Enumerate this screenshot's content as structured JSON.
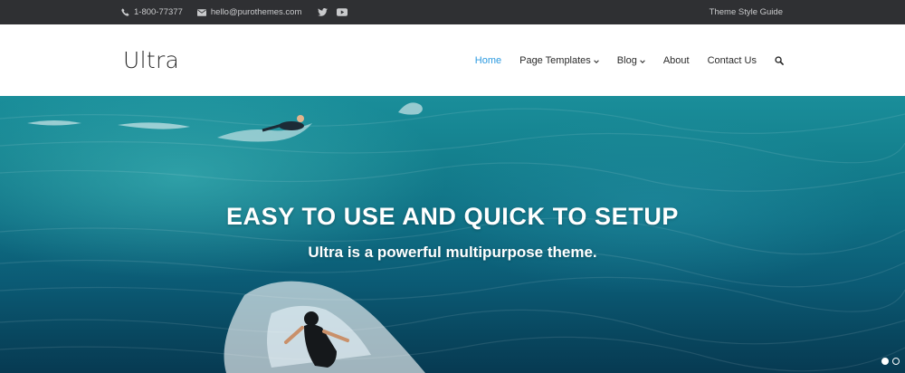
{
  "topbar": {
    "phone": "1-800-77377",
    "email": "hello@purothemes.com",
    "social_icons": [
      "twitter-icon",
      "youtube-icon"
    ],
    "style_guide_link": "Theme Style Guide"
  },
  "header": {
    "logo": "Ultra",
    "nav": [
      {
        "label": "Home",
        "active": true,
        "has_dropdown": false
      },
      {
        "label": "Page Templates",
        "active": false,
        "has_dropdown": true
      },
      {
        "label": "Blog",
        "active": false,
        "has_dropdown": true
      },
      {
        "label": "About",
        "active": false,
        "has_dropdown": false
      },
      {
        "label": "Contact Us",
        "active": false,
        "has_dropdown": false
      }
    ],
    "search_icon": "search-icon"
  },
  "hero": {
    "headline": "EASY TO USE AND QUICK TO SETUP",
    "subline": "Ultra is a powerful multipurpose theme.",
    "slides_total": 2,
    "slide_active": 1
  },
  "colors": {
    "topbar_bg": "#2f3033",
    "accent": "#2b9ae0",
    "text_dark": "#2b2b2b",
    "ocean": "#0f6f84"
  }
}
